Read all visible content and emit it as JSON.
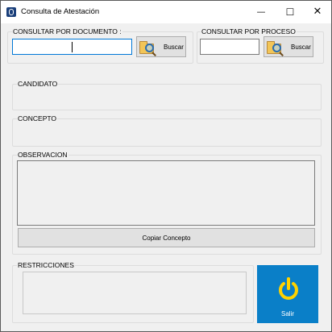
{
  "window": {
    "title": "Consulta de Atestación",
    "controls": {
      "minimize": "—",
      "maximize": "☐",
      "close": "✕"
    }
  },
  "search_document": {
    "group_label": "CONSULTAR POR DOCUMENTO :",
    "input_value": "",
    "button_label": "Buscar"
  },
  "search_process": {
    "group_label": "CONSULTAR POR PROCESO",
    "input_value": "",
    "button_label": "Buscar"
  },
  "candidato": {
    "label": "CANDIDATO",
    "value": ""
  },
  "concepto": {
    "label": "CONCEPTO",
    "value": ""
  },
  "observacion": {
    "label": "OBSERVACION",
    "value": ""
  },
  "copy_button": {
    "label": "Copiar Concepto"
  },
  "restricciones": {
    "label": "RESTRICCIONES",
    "value": ""
  },
  "exit_button": {
    "label": "Salir",
    "color": "#0a7fc8",
    "icon_color": "#ffd200"
  },
  "colors": {
    "window_bg": "#f0f0f0",
    "focus_border": "#0078d7"
  }
}
